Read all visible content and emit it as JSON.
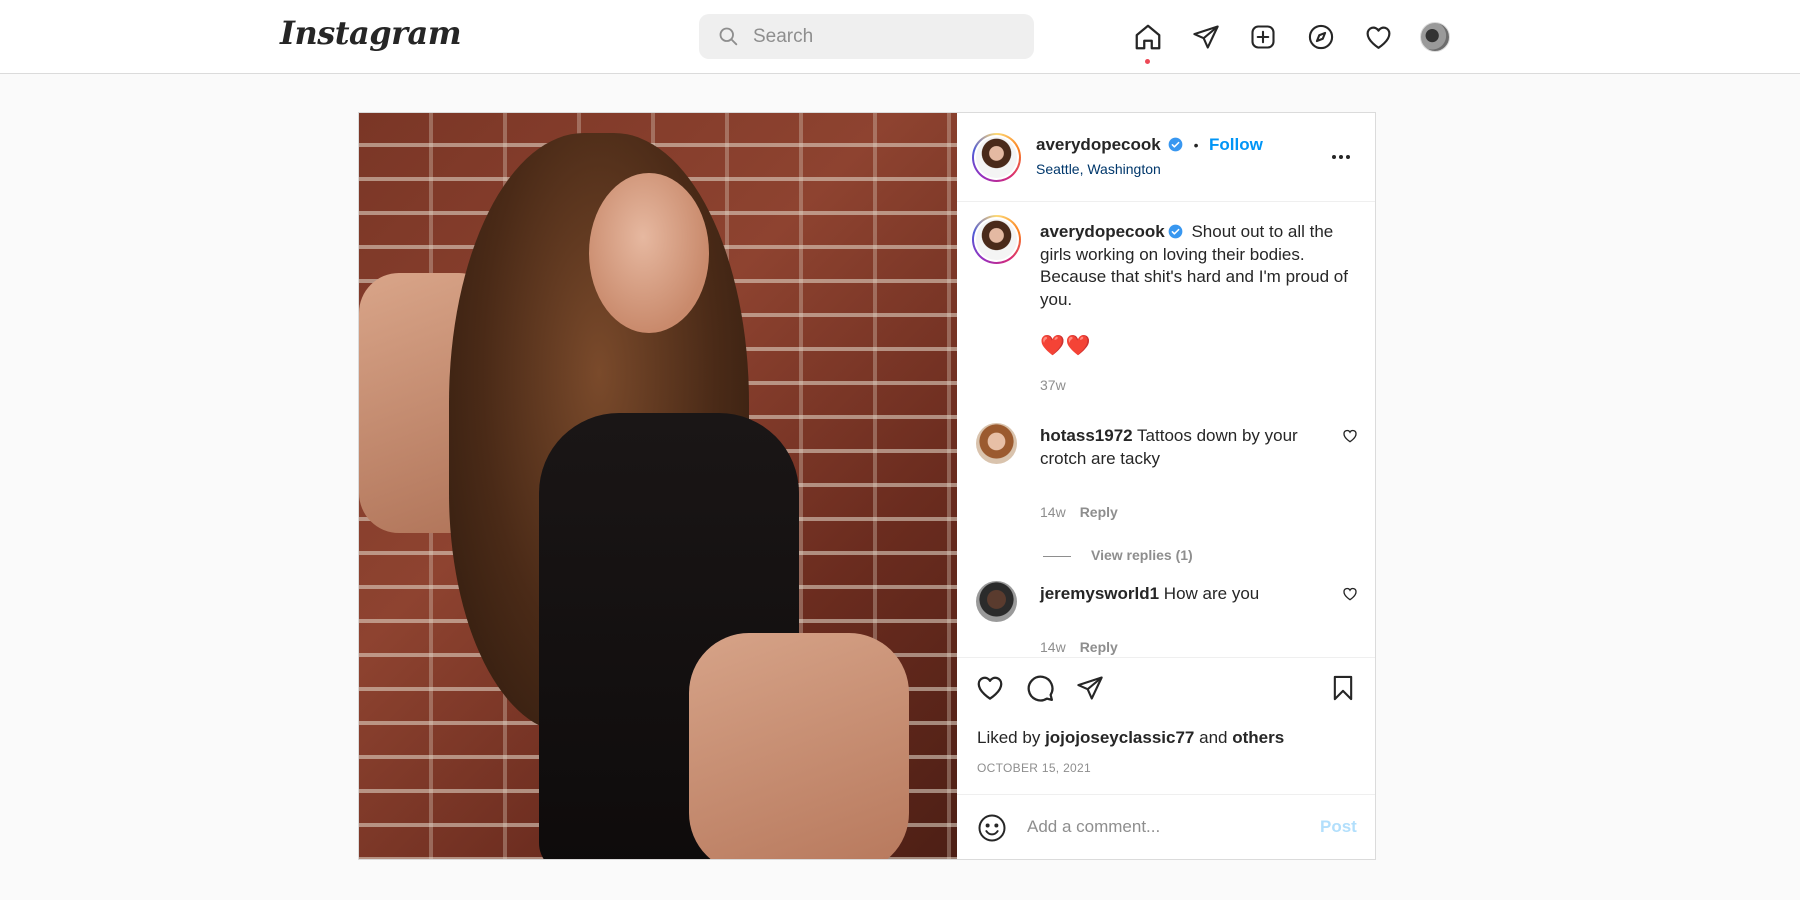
{
  "header": {
    "logo": "Instagram",
    "search_placeholder": "Search",
    "nav_icons": [
      "home-icon",
      "direct-message-icon",
      "new-post-icon",
      "explore-icon",
      "activity-heart-icon",
      "profile-avatar"
    ]
  },
  "post": {
    "author": {
      "username": "averydopecook",
      "verified": true,
      "separator": "•",
      "follow_label": "Follow",
      "location": "Seattle, Washington"
    },
    "caption": {
      "username": "averydopecook",
      "text": "Shout out to all the girls working on loving their bodies. Because that shit's hard and I'm proud of you.",
      "emojis": "❤️❤️",
      "age": "37w"
    },
    "comments": [
      {
        "username": "hotass1972",
        "text": "Tattoos down by your crotch are tacky",
        "age": "14w",
        "reply_label": "Reply"
      },
      {
        "username": "jeremysworld1",
        "text": "How are you",
        "age": "14w",
        "reply_label": "Reply"
      }
    ],
    "view_replies": "View replies (1)",
    "liked_by": {
      "prefix": "Liked by",
      "user": "jojojoseyclassic77",
      "joiner": "and",
      "others": "others"
    },
    "date": "OCTOBER 15, 2021",
    "add_comment_placeholder": "Add a comment...",
    "post_button": "Post"
  },
  "colors": {
    "accent": "#0095f6",
    "notification_dot": "#ed4956",
    "disabled_post": "#b2dffc"
  }
}
